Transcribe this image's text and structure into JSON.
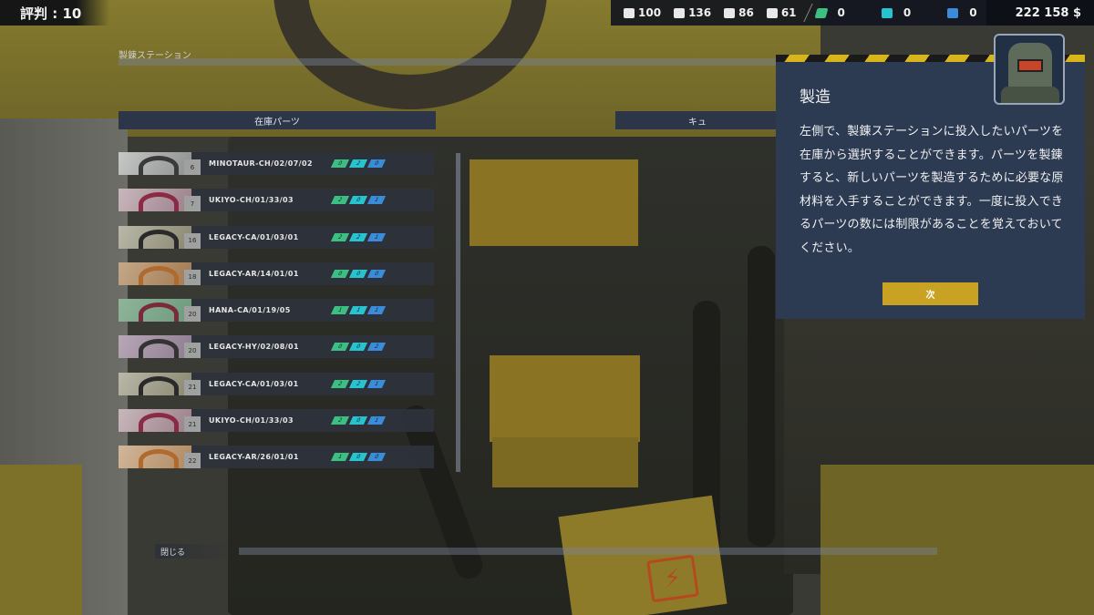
{
  "hud": {
    "reputation": "評判 : 10",
    "resources": [
      {
        "icon": "crate-icon",
        "value": "100"
      },
      {
        "icon": "book-icon",
        "value": "136"
      },
      {
        "icon": "wrench-icon",
        "value": "86"
      },
      {
        "icon": "gear-icon",
        "value": "61"
      }
    ],
    "materials": [
      {
        "icon": "green-material-icon",
        "color": "#3dbf84",
        "value": "0"
      },
      {
        "icon": "cyan-material-icon",
        "color": "#27c3cf",
        "value": "0"
      },
      {
        "icon": "blue-material-icon",
        "color": "#3a8bd8",
        "value": "0"
      }
    ],
    "money": "222 158 $"
  },
  "station": {
    "title": "製錬ステーション",
    "inventory_header": "在庫パーツ",
    "queue_header": "キュ",
    "close_label": "閉じる"
  },
  "parts": [
    {
      "name": "MINOTAUR-CH/02/07/02",
      "qty": "6",
      "chips": [
        "0",
        "2",
        "0"
      ]
    },
    {
      "name": "UKIYO-CH/01/33/03",
      "qty": "7",
      "chips": [
        "2",
        "0",
        "1"
      ]
    },
    {
      "name": "LEGACY-CA/01/03/01",
      "qty": "16",
      "chips": [
        "2",
        "2",
        "1"
      ]
    },
    {
      "name": "LEGACY-AR/14/01/01",
      "qty": "18",
      "chips": [
        "0",
        "0",
        "0"
      ]
    },
    {
      "name": "HANA-CA/01/19/05",
      "qty": "20",
      "chips": [
        "1",
        "1",
        "1"
      ]
    },
    {
      "name": "LEGACY-HY/02/08/01",
      "qty": "20",
      "chips": [
        "0",
        "0",
        "2"
      ]
    },
    {
      "name": "LEGACY-CA/01/03/01",
      "qty": "21",
      "chips": [
        "2",
        "2",
        "1"
      ]
    },
    {
      "name": "UKIYO-CH/01/33/03",
      "qty": "21",
      "chips": [
        "2",
        "0",
        "1"
      ]
    },
    {
      "name": "LEGACY-AR/26/01/01",
      "qty": "22",
      "chips": [
        "1",
        "0",
        "0"
      ]
    }
  ],
  "tutorial": {
    "title": "製造",
    "body": "左側で、製錬ステーションに投入したいパーツを在庫から選択することができます。パーツを製錬すると、新しいパーツを製造するために必要な原材料を入手することができます。一度に投入できるパーツの数には制限があることを覚えておいてください。",
    "next_label": "次"
  },
  "colors": {
    "accent_yellow": "#c9a224",
    "panel_blue": "#2c3a52",
    "chip_green": "#3dbf84",
    "chip_cyan": "#27c3cf",
    "chip_blue": "#3a8bd8"
  }
}
